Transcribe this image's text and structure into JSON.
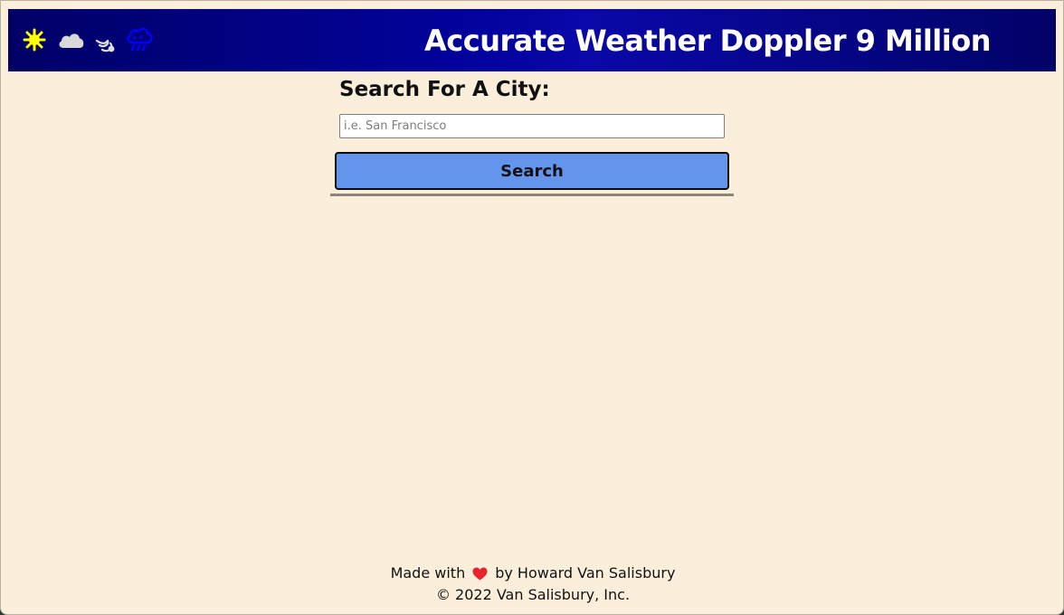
{
  "header": {
    "title": "Accurate Weather Doppler 9 Million",
    "icons": [
      "sun-icon",
      "cloud-icon",
      "wind-icon",
      "rain-cloud-icon"
    ],
    "background_colors": [
      "#010066",
      "#02029e",
      "#020267"
    ]
  },
  "search": {
    "heading": "Search For A City:",
    "placeholder": "i.e. San Francisco",
    "value": "",
    "button_label": "Search",
    "button_color": "#6495ed"
  },
  "footer": {
    "made_with": "Made with",
    "by": "by Howard Van Salisbury",
    "heart_icon": "heart-icon",
    "copyright": "© 2022 Van Salisbury, Inc."
  },
  "colors": {
    "page_background": "#fbefdb",
    "heart": "#e8232b",
    "sun": "#ffff00",
    "cloud": "#d8d8d8",
    "rain_cloud": "#0000ff"
  }
}
